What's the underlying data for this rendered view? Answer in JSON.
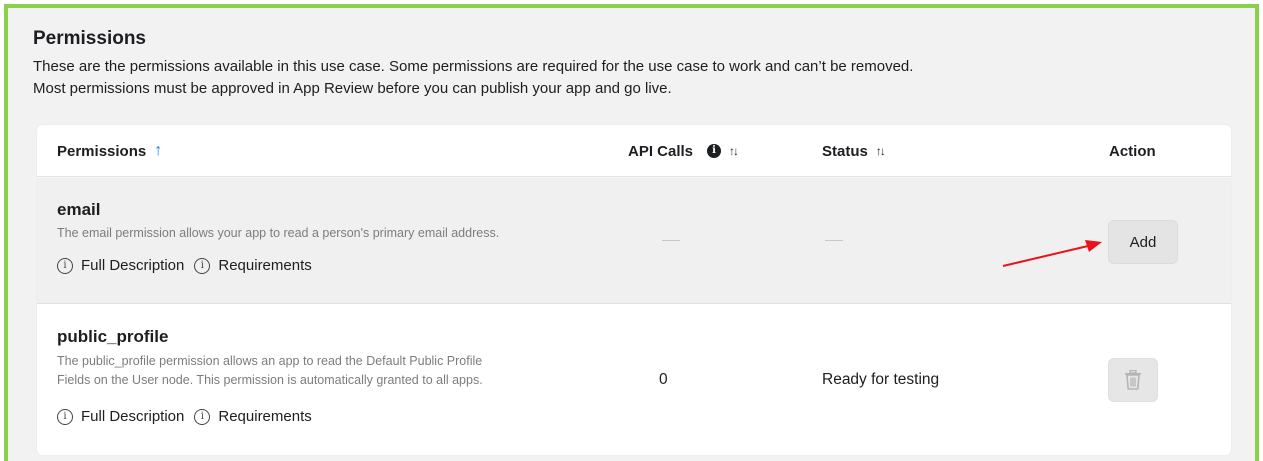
{
  "section": {
    "title": "Permissions",
    "description_line1": "These are the permissions available in this use case. Some permissions are required for the use case to work and can’t be removed.",
    "description_line2": "Most permissions must be approved in App Review before you can publish your app and go live."
  },
  "table": {
    "headers": {
      "permissions": "Permissions",
      "api_calls": "API Calls",
      "status": "Status",
      "action": "Action"
    },
    "rows": [
      {
        "name": "email",
        "description": "The email permission allows your app to read a person's primary email address.",
        "full_description": "Full Description",
        "requirements": "Requirements",
        "api_calls": "—",
        "status": "—",
        "action_label": "Add"
      },
      {
        "name": "public_profile",
        "description_line1": "The public_profile permission allows an app to read the Default Public Profile",
        "description_line2": "Fields on the User node. This permission is automatically granted to all apps.",
        "full_description": "Full Description",
        "requirements": "Requirements",
        "api_calls": "0",
        "status": "Ready for testing",
        "action_icon": "trash-icon"
      }
    ]
  },
  "colors": {
    "frame_border": "#8bd04a",
    "sort_active": "#1877f2",
    "annotation_arrow": "#e8141b"
  }
}
